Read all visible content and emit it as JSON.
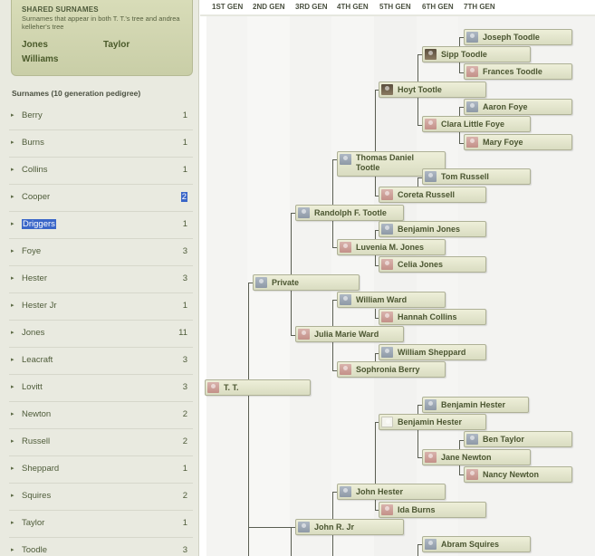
{
  "shared_surnames": {
    "title": "SHARED SURNAMES",
    "description": "Surnames that appear in both T. T.'s tree and andrea kelleher's tree",
    "names": [
      "Jones",
      "Taylor",
      "Williams"
    ]
  },
  "surname_list": {
    "header": "Surnames (10 generation pedigree)",
    "items": [
      {
        "name": "Berry",
        "count": "1"
      },
      {
        "name": "Burns",
        "count": "1"
      },
      {
        "name": "Collins",
        "count": "1"
      },
      {
        "name": "Cooper",
        "count": "2"
      },
      {
        "name": "Driggers",
        "count": "1"
      },
      {
        "name": "Foye",
        "count": "3"
      },
      {
        "name": "Hester",
        "count": "3"
      },
      {
        "name": "Hester Jr",
        "count": "1"
      },
      {
        "name": "Jones",
        "count": "11"
      },
      {
        "name": "Leacraft",
        "count": "3"
      },
      {
        "name": "Lovitt",
        "count": "3"
      },
      {
        "name": "Newton",
        "count": "2"
      },
      {
        "name": "Russell",
        "count": "2"
      },
      {
        "name": "Sheppard",
        "count": "1"
      },
      {
        "name": "Squires",
        "count": "2"
      },
      {
        "name": "Taylor",
        "count": "1"
      },
      {
        "name": "Toodle",
        "count": "3"
      }
    ]
  },
  "generations": [
    "1ST GEN",
    "2ND GEN",
    "3RD GEN",
    "4TH GEN",
    "5TH GEN",
    "6TH GEN",
    "7TH GEN"
  ],
  "people": [
    {
      "name": "Joseph Toodle",
      "icon": "male"
    },
    {
      "name": "Sipp Toodle",
      "icon": "photo"
    },
    {
      "name": "Frances Toodle",
      "icon": "female"
    },
    {
      "name": "Hoyt Tootle",
      "icon": "photo"
    },
    {
      "name": "Aaron Foye",
      "icon": "male"
    },
    {
      "name": "Clara Little Foye",
      "icon": "female"
    },
    {
      "name": "Mary Foye",
      "icon": "female"
    },
    {
      "name": "Thomas Daniel Tootle",
      "icon": "male"
    },
    {
      "name": "Tom Russell",
      "icon": "male"
    },
    {
      "name": "Coreta Russell",
      "icon": "female"
    },
    {
      "name": "Randolph F. Tootle",
      "icon": "male"
    },
    {
      "name": "Benjamin Jones",
      "icon": "male"
    },
    {
      "name": "Luvenia M. Jones",
      "icon": "female"
    },
    {
      "name": "Celia Jones",
      "icon": "female"
    },
    {
      "name": "Private",
      "icon": "male"
    },
    {
      "name": "William Ward",
      "icon": "male"
    },
    {
      "name": "Hannah Collins",
      "icon": "female"
    },
    {
      "name": "Julia Marie Ward",
      "icon": "female"
    },
    {
      "name": "William Sheppard",
      "icon": "male"
    },
    {
      "name": "Sophronia Berry",
      "icon": "female"
    },
    {
      "name": "T. T.",
      "icon": "female"
    },
    {
      "name": "Benjamin Hester",
      "icon": "male"
    },
    {
      "name": "Benjamin Hester",
      "icon": "blank"
    },
    {
      "name": "Ben Taylor",
      "icon": "male"
    },
    {
      "name": "Jane Newton",
      "icon": "female"
    },
    {
      "name": "Nancy Newton",
      "icon": "female"
    },
    {
      "name": "John Hester",
      "icon": "male"
    },
    {
      "name": "Ida Burns",
      "icon": "female"
    },
    {
      "name": "John R. Jr",
      "icon": "male"
    },
    {
      "name": "Abram Squires",
      "icon": "male"
    }
  ]
}
